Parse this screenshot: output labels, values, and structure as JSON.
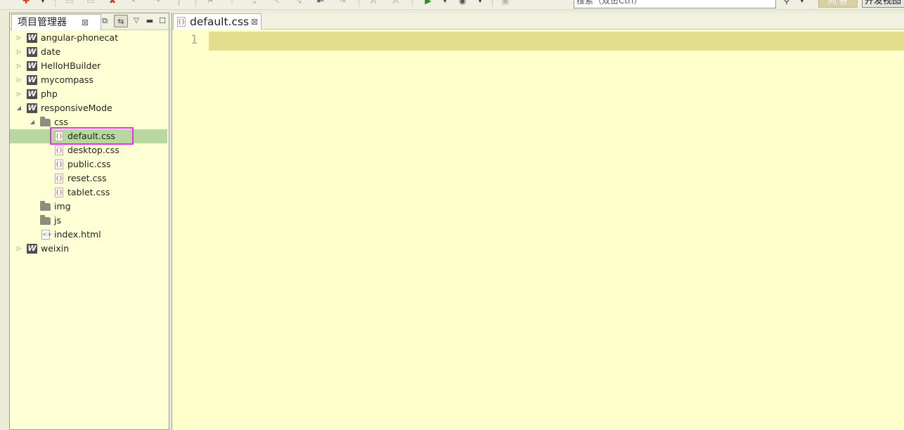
{
  "toolbar": {
    "search_placeholder": "搜索（双击Ctrl）",
    "command_button": "问 答",
    "view_button": "开发视图"
  },
  "project_panel": {
    "title": "项目管理器",
    "tree": [
      {
        "label": "angular-phonecat",
        "type": "project",
        "expanded": false
      },
      {
        "label": "date",
        "type": "project",
        "expanded": false
      },
      {
        "label": "HelloHBuilder",
        "type": "project",
        "expanded": false
      },
      {
        "label": "mycompass",
        "type": "project",
        "expanded": false
      },
      {
        "label": "php",
        "type": "project",
        "expanded": false
      },
      {
        "label": "responsiveMode",
        "type": "project",
        "expanded": true
      },
      {
        "label": "css",
        "type": "folder",
        "expanded": true
      },
      {
        "label": "default.css",
        "type": "css-file",
        "selected": true
      },
      {
        "label": "desktop.css",
        "type": "css-file"
      },
      {
        "label": "public.css",
        "type": "css-file"
      },
      {
        "label": "reset.css",
        "type": "css-file"
      },
      {
        "label": "tablet.css",
        "type": "css-file"
      },
      {
        "label": "img",
        "type": "folder"
      },
      {
        "label": "js",
        "type": "folder"
      },
      {
        "label": "index.html",
        "type": "html-file"
      },
      {
        "label": "weixin",
        "type": "project",
        "expanded": false
      }
    ]
  },
  "editor": {
    "tab_label": "default.css",
    "line_numbers": [
      "1"
    ],
    "current_line_color": "#e3dd8c",
    "background_color": "#ffffcc"
  }
}
